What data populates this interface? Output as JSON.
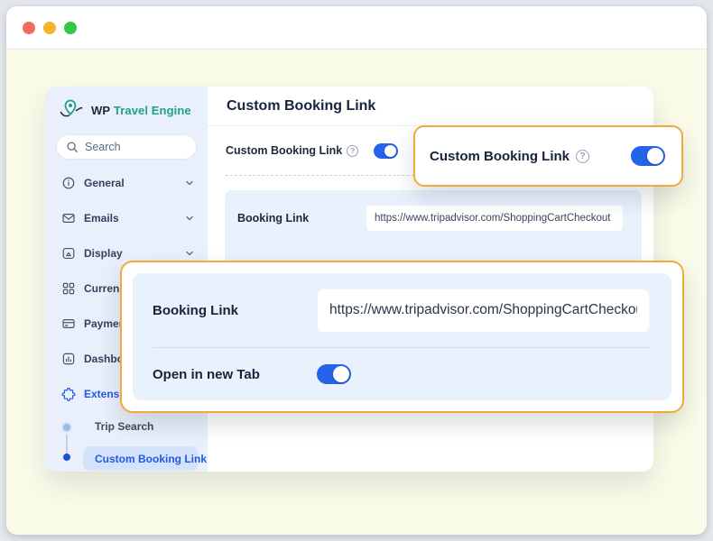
{
  "window": {
    "controls": [
      "close",
      "minimize",
      "zoom"
    ]
  },
  "sidebar": {
    "brand": {
      "prefix": "WP",
      "name": "Travel Engine"
    },
    "search": {
      "placeholder": "Search"
    },
    "items": [
      {
        "label": "General",
        "icon": "info-circle",
        "expandable": true
      },
      {
        "label": "Emails",
        "icon": "envelope",
        "expandable": true
      },
      {
        "label": "Display",
        "icon": "display",
        "expandable": true
      },
      {
        "label": "Currencies",
        "icon": "grid",
        "expandable": true
      },
      {
        "label": "Payments",
        "icon": "credit-card",
        "expandable": true
      },
      {
        "label": "Dashboard",
        "icon": "bar-chart",
        "expandable": true
      },
      {
        "label": "Extensions",
        "icon": "puzzle",
        "expandable": true,
        "active": true
      }
    ],
    "sub_items": [
      {
        "label": "Trip Search",
        "active": false
      },
      {
        "label": "Custom Booking Link",
        "active": true
      }
    ]
  },
  "main": {
    "title": "Custom Booking Link",
    "toggle_row": {
      "label": "Custom Booking Link",
      "has_help": true,
      "enabled": true
    },
    "panel": {
      "booking_link": {
        "label": "Booking Link",
        "value": "https://www.tripadvisor.com/ShoppingCartCheckout"
      }
    }
  },
  "callout_toggle": {
    "label": "Custom Booking Link",
    "has_help": true,
    "enabled": true
  },
  "callout_panel": {
    "booking_link_label": "Booking Link",
    "booking_link_value": "https://www.tripadvisor.com/ShoppingCartCheckout",
    "open_new_tab_label": "Open in new Tab",
    "open_new_tab_enabled": true
  },
  "colors": {
    "accent_blue": "#2563EB",
    "brand_teal": "#1FA08F",
    "highlight_orange": "#F0AA3C",
    "sidebar_bg": "#E9F0FB",
    "panel_bg": "#E9F1FC",
    "page_bg": "#FBFBE9"
  }
}
